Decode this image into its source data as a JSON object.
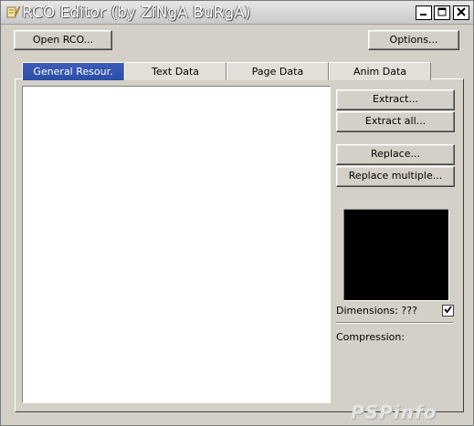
{
  "window": {
    "title": "RCO Editor (by ZiNgA BuRgA)",
    "icon": "pencil-icon"
  },
  "toolbar": {
    "open_label": "Open RCO...",
    "options_label": "Options..."
  },
  "tabs": [
    {
      "label": "General Resour.",
      "active": true
    },
    {
      "label": "Text Data",
      "active": false
    },
    {
      "label": "Page Data",
      "active": false
    },
    {
      "label": "Anim Data",
      "active": false
    }
  ],
  "actions": {
    "extract_label": "Extract...",
    "extract_all_label": "Extract all...",
    "replace_label": "Replace...",
    "replace_multiple_label": "Replace multiple..."
  },
  "preview": {
    "dimensions_label": "Dimensions: ???",
    "dimensions_checked": true,
    "compression_label": "Compression:"
  },
  "watermark": "PSPinfo",
  "colors": {
    "face": "#d4d0c8",
    "active_tab": "#2f52aa",
    "preview_bg": "#000000"
  }
}
